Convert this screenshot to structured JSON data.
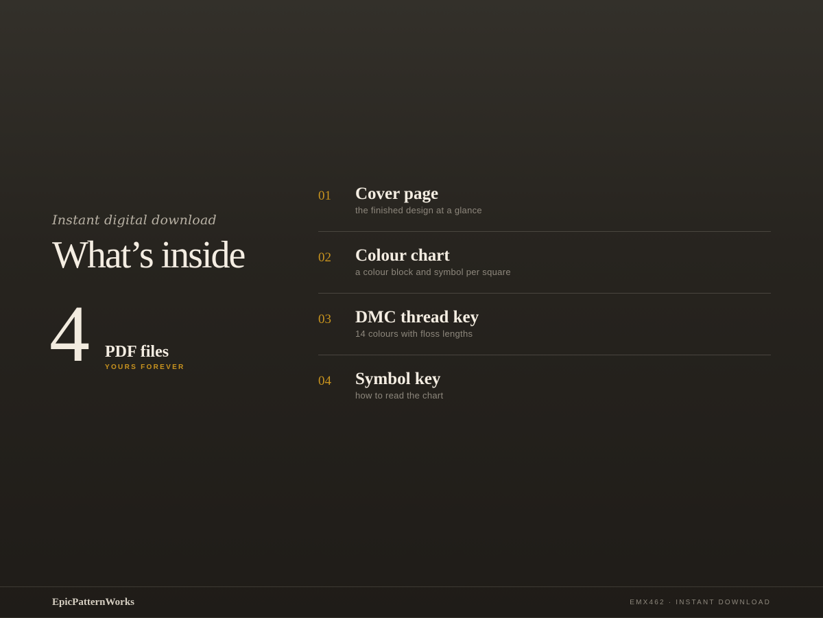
{
  "hero": {
    "eyebrow": "Instant digital download",
    "title": "What’s inside",
    "count": "4",
    "count_label": "PDF files",
    "count_sub": "YOURS FOREVER"
  },
  "items": [
    {
      "num": "01",
      "title": "Cover page",
      "desc": "the finished design at a glance"
    },
    {
      "num": "02",
      "title": "Colour chart",
      "desc": "a colour block and symbol per square"
    },
    {
      "num": "03",
      "title": "DMC thread key",
      "desc": "14 colours with floss lengths"
    },
    {
      "num": "04",
      "title": "Symbol key",
      "desc": "how to read the chart"
    }
  ],
  "footer": {
    "brand": "EpicPatternWorks",
    "meta": "EMX462 · INSTANT DOWNLOAD"
  },
  "colors": {
    "accent": "#c9941e",
    "background": "#27241f",
    "text": "#f4ede2",
    "muted": "#8e887d"
  }
}
